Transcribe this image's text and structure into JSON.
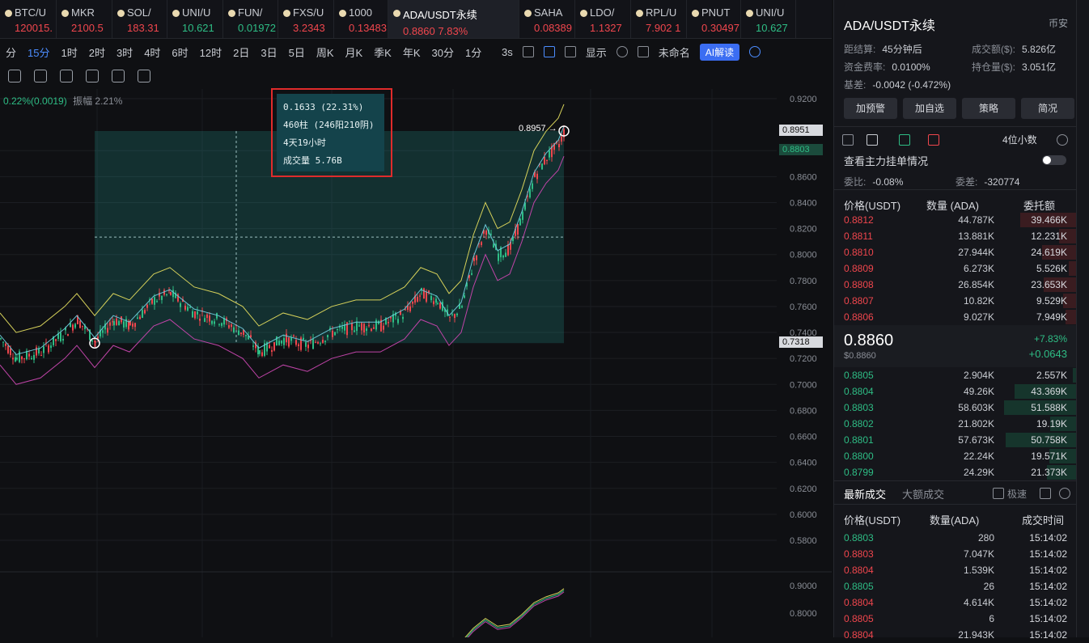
{
  "tabs": [
    {
      "name": "BTC/U",
      "price": "120015.",
      "dir": "dn"
    },
    {
      "name": "MKR",
      "price": "2100.5",
      "dir": "dn"
    },
    {
      "name": "SOL/",
      "price": "183.31",
      "dir": "dn"
    },
    {
      "name": "UNI/U",
      "price": "10.621",
      "dir": "up"
    },
    {
      "name": "FUN/",
      "price": "0.01972",
      "dir": "up"
    },
    {
      "name": "FXS/U",
      "price": "3.2343",
      "dir": "dn"
    },
    {
      "name": "1000",
      "price": "0.13483",
      "dir": "dn"
    },
    {
      "name": "ADA/USDT永续",
      "price": "0.8860  7.83%",
      "dir": "dn"
    },
    {
      "name": "SAHA",
      "price": "0.08389",
      "dir": "dn"
    },
    {
      "name": "LDO/",
      "price": "1.1327",
      "dir": "dn"
    },
    {
      "name": "RPL/U",
      "price": "7.902  1",
      "dir": "dn"
    },
    {
      "name": "PNUT",
      "price": "0.30497",
      "dir": "dn"
    },
    {
      "name": "UNI/U",
      "price": "10.627",
      "dir": "up"
    }
  ],
  "timeframes": [
    "分",
    "15分",
    "1时",
    "2时",
    "3时",
    "4时",
    "6时",
    "12时",
    "2日",
    "3日",
    "5日",
    "周K",
    "月K",
    "季K",
    "年K",
    "30分",
    "1分"
  ],
  "toolbar": {
    "interval": "3s",
    "display": "显示",
    "layout": "未命名",
    "ai": "AI解读"
  },
  "chart_info": {
    "change": "0.22%(0.0019)",
    "amplitude": "振幅 2.21%"
  },
  "measure": {
    "line1": "0.1633 (22.31%)",
    "line2": "460柱 (246阳210阴)",
    "line3": "4天19小时",
    "line4": "成交量 5.76B",
    "end_label": "0.8957 →"
  },
  "price_axis": [
    "0.9200",
    "0.8800",
    "0.8600",
    "0.8400",
    "0.8200",
    "0.8000",
    "0.7800",
    "0.7600",
    "0.7400",
    "0.7200",
    "0.7000",
    "0.6800",
    "0.6600",
    "0.6400",
    "0.6200",
    "0.6000",
    "0.5800"
  ],
  "price_tags": {
    "top": "0.8951",
    "last": "0.8803",
    "low": "0.7318"
  },
  "sub_axis": [
    "0.9000",
    "0.8000"
  ],
  "panel": {
    "title": "ADA/USDT永续",
    "exchange": "币安",
    "settle_label": "距结算:",
    "settle_value": "45分钟后",
    "vol_label": "成交额($):",
    "vol_value": "5.826亿",
    "fund_label": "资金费率:",
    "fund_value": "0.0100%",
    "oi_label": "持仓量($):",
    "oi_value": "3.051亿",
    "basis_label": "基差:",
    "basis_value": "-0.0042 (-0.472%)",
    "buttons": [
      "加预警",
      "加自选",
      "策略",
      "简况"
    ],
    "decimals": "4位小数",
    "depth_label": "查看主力挂单情况",
    "ratio_label": "委比:",
    "ratio_value": "-0.08%",
    "diff_label": "委差:",
    "diff_value": "-320774",
    "ob_headers": [
      "价格(USDT)",
      "数量 (ADA)",
      "委托额"
    ],
    "asks": [
      {
        "p": "0.8812",
        "q": "44.787K",
        "t": "39.466K",
        "w": 0.78
      },
      {
        "p": "0.8811",
        "q": "13.881K",
        "t": "12.231K",
        "w": 0.24
      },
      {
        "p": "0.8810",
        "q": "27.944K",
        "t": "24.619K",
        "w": 0.48
      },
      {
        "p": "0.8809",
        "q": "6.273K",
        "t": "5.526K",
        "w": 0.11
      },
      {
        "p": "0.8808",
        "q": "26.854K",
        "t": "23.653K",
        "w": 0.46
      },
      {
        "p": "0.8807",
        "q": "10.82K",
        "t": "9.529K",
        "w": 0.19
      },
      {
        "p": "0.8806",
        "q": "9.027K",
        "t": "7.949K",
        "w": 0.16
      }
    ],
    "last_price": "0.8860",
    "last_usd": "$0.8860",
    "last_pct": "+7.83%",
    "last_chg": "+0.0643",
    "bids": [
      {
        "p": "0.8805",
        "q": "2.904K",
        "t": "2.557K",
        "w": 0.05
      },
      {
        "p": "0.8804",
        "q": "49.26K",
        "t": "43.369K",
        "w": 0.86
      },
      {
        "p": "0.8803",
        "q": "58.603K",
        "t": "51.588K",
        "w": 1.0
      },
      {
        "p": "0.8802",
        "q": "21.802K",
        "t": "19.19K",
        "w": 0.37
      },
      {
        "p": "0.8801",
        "q": "57.673K",
        "t": "50.758K",
        "w": 0.98
      },
      {
        "p": "0.8800",
        "q": "22.24K",
        "t": "19.571K",
        "w": 0.38
      },
      {
        "p": "0.8799",
        "q": "24.29K",
        "t": "21.373K",
        "w": 0.41
      }
    ],
    "trade_tabs": [
      "最新成交",
      "大额成交"
    ],
    "fast_label": "极速",
    "trade_headers": [
      "价格(USDT)",
      "数量(ADA)",
      "成交时间"
    ],
    "trades": [
      {
        "p": "0.8803",
        "q": "280",
        "t": "15:14:02",
        "dir": "up"
      },
      {
        "p": "0.8803",
        "q": "7.047K",
        "t": "15:14:02",
        "dir": "dn"
      },
      {
        "p": "0.8804",
        "q": "1.539K",
        "t": "15:14:02",
        "dir": "dn"
      },
      {
        "p": "0.8805",
        "q": "26",
        "t": "15:14:02",
        "dir": "up"
      },
      {
        "p": "0.8804",
        "q": "4.614K",
        "t": "15:14:02",
        "dir": "dn"
      },
      {
        "p": "0.8805",
        "q": "6",
        "t": "15:14:02",
        "dir": "dn"
      },
      {
        "p": "0.8804",
        "q": "21.943K",
        "t": "15:14:02",
        "dir": "dn"
      }
    ]
  }
}
